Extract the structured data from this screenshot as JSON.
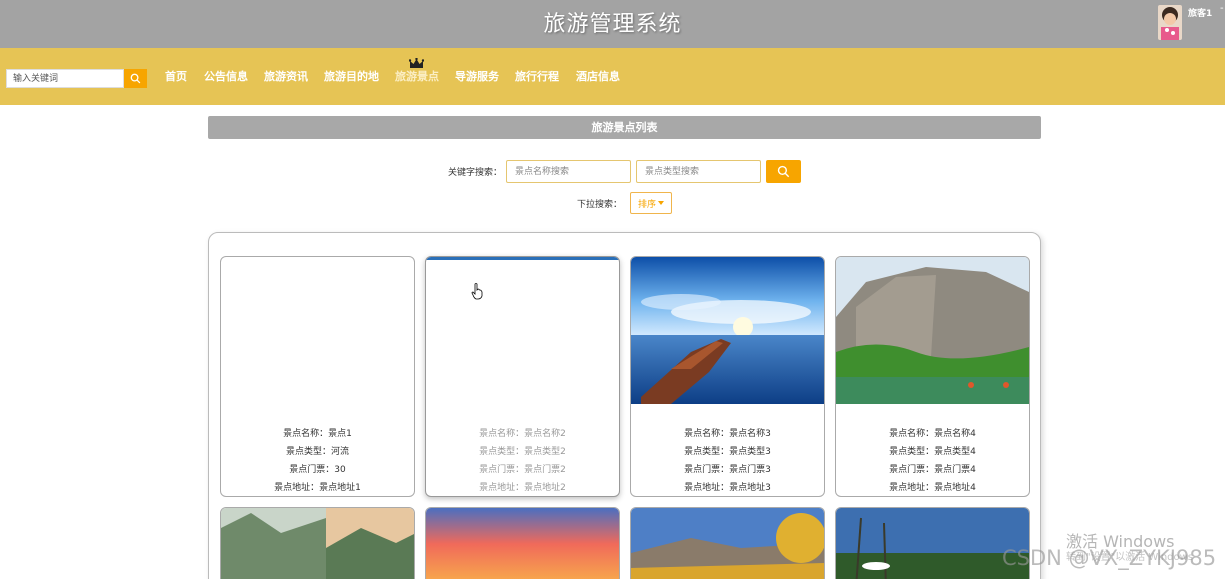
{
  "header": {
    "title": "旅游管理系统",
    "username": "旅客1",
    "separator": "-"
  },
  "nav": {
    "search_placeholder": "输入关键词",
    "items": [
      "首页",
      "公告信息",
      "旅游资讯",
      "旅游目的地",
      "旅游景点",
      "导游服务",
      "旅行行程",
      "酒店信息"
    ],
    "active_index": 4
  },
  "section": {
    "title": "旅游景点列表",
    "keyword_label": "关键字搜索：",
    "name_placeholder": "景点名称搜索",
    "type_placeholder": "景点类型搜索",
    "dropdown_label": "下拉搜索：",
    "sort_label": "排序"
  },
  "cards": [
    {
      "lines": [
        "景点名称：景点1",
        "景点类型：河流",
        "景点门票：30",
        "景点地址：景点地址1"
      ]
    },
    {
      "lines": [
        "景点名称：景点名称2",
        "景点类型：景点类型2",
        "景点门票：景点门票2",
        "景点地址：景点地址2"
      ]
    },
    {
      "lines": [
        "景点名称：景点名称3",
        "景点类型：景点类型3",
        "景点门票：景点门票3",
        "景点地址：景点地址3"
      ]
    },
    {
      "lines": [
        "景点名称：景点名称4",
        "景点类型：景点类型4",
        "景点门票：景点门票4",
        "景点地址：景点地址4"
      ]
    }
  ],
  "watermarks": {
    "windows_activate": "激活 Windows",
    "windows_sub": "转到\"设置\"以激活 Windows",
    "csdn": "CSDN @VX_ZYKJ985"
  },
  "colors": {
    "topbar": "#a3a3a3",
    "navbar": "#e6c455",
    "accent": "#f7a500",
    "section_header": "#a8a8a8"
  }
}
